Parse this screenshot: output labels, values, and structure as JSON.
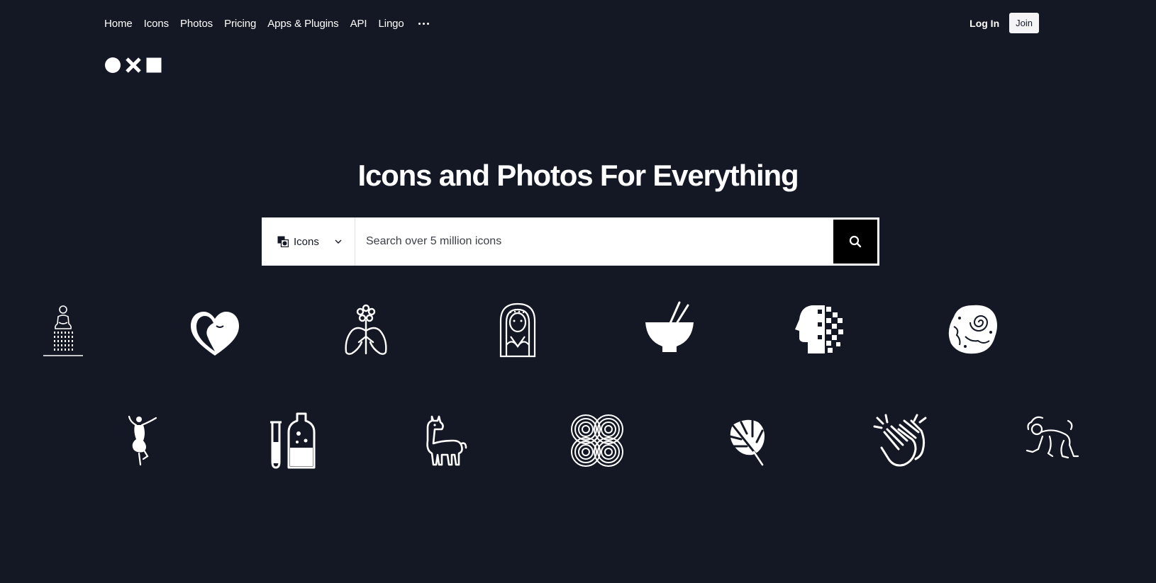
{
  "nav": {
    "items": [
      {
        "label": "Home"
      },
      {
        "label": "Icons"
      },
      {
        "label": "Photos"
      },
      {
        "label": "Pricing"
      },
      {
        "label": "Apps & Plugins"
      },
      {
        "label": "API"
      },
      {
        "label": "Lingo"
      }
    ],
    "more_icon": "more-horizontal-icon",
    "login_label": "Log In",
    "join_label": "Join"
  },
  "logo": {
    "shapes": [
      "circle",
      "cross",
      "square"
    ]
  },
  "hero": {
    "title": "Icons and Photos For Everything"
  },
  "search": {
    "type_label": "Icons",
    "type_icon": "icons-type-icon",
    "placeholder": "Search over 5 million icons",
    "button_icon": "search-icon"
  },
  "showcase": {
    "row1": [
      "meditating-person-icon",
      "heart-face-icon",
      "flower-lungs-icon",
      "woman-portrait-icon",
      "bowl-chopsticks-icon",
      "pixel-head-icon",
      "rock-spiral-icon"
    ],
    "row2": [
      "dancer-icon",
      "test-tubes-icon",
      "llama-icon",
      "interlocking-circles-icon",
      "monstera-leaf-icon",
      "clapping-hands-icon",
      "crawling-figure-icon"
    ]
  },
  "colors": {
    "background": "#141824",
    "text": "#ffffff",
    "search_button": "#000000"
  }
}
